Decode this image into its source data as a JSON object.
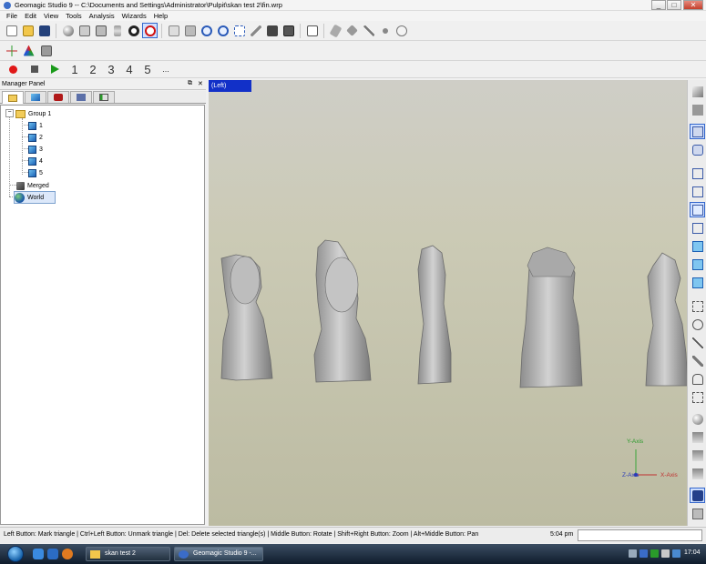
{
  "window": {
    "title": "Geomagic Studio 9 -- C:\\Documents and Settings\\Administrator\\Pulpit\\skan test 2\\fin.wrp",
    "controls": [
      "_",
      "□",
      "✕"
    ]
  },
  "menu": [
    "File",
    "Edit",
    "View",
    "Tools",
    "Analysis",
    "Wizards",
    "Help"
  ],
  "toolbar1": {
    "icons": [
      "new-file-icon",
      "open-folder-icon",
      "save-icon",
      "sphere-icon",
      "cube-view-icon",
      "box-icon",
      "hourglass-icon",
      "rotate-center-icon",
      "target-icon",
      "flat-shade-icon",
      "face-icon",
      "zoom-in-icon",
      "zoom-out-icon",
      "zoom-window-icon",
      "pencil-icon",
      "camera-icon",
      "multi-view-icon",
      "export-icon",
      "eraser-icon",
      "erase-box-icon",
      "pointer-icon",
      "dot-icon",
      "no-entry-icon"
    ]
  },
  "toolbar2": {
    "icons": [
      "axes-icon",
      "color-triangle-icon",
      "transform-icon"
    ]
  },
  "macro_bar": {
    "record_color": "#e01818",
    "stop_color": "#555555",
    "play_color": "#1a9a1a",
    "slots": [
      "1",
      "2",
      "3",
      "4",
      "5",
      "..."
    ]
  },
  "manager_panel": {
    "title": "Manager Panel",
    "pin": "⧉",
    "close": "✕",
    "tabs": [
      "model-manager-tab",
      "layer-tab",
      "display-tab",
      "display-settings-tab",
      "statistics-tab"
    ],
    "tree": {
      "group": "Group 1",
      "expander": "−",
      "children": [
        "1",
        "2",
        "3",
        "4",
        "5"
      ],
      "merged": "Merged",
      "world": "World"
    }
  },
  "viewport": {
    "view_name": "(Left)",
    "background_top": "#cfcec7",
    "background_bottom": "#bcbba2",
    "axes": {
      "y": "Y-Axis",
      "x": "X-Axis",
      "z": "Z-Axis"
    }
  },
  "right_toolbar": {
    "icons": [
      "shade-gradient-icon",
      "shade-flat-icon",
      "plane-icon",
      "cylinder-icon",
      "cube-wire-1-icon",
      "cube-wire-2-icon",
      "cube-wire-3-icon",
      "cube-wire-4-icon",
      "cube-solid-1-icon",
      "cube-solid-2-icon",
      "cube-solid-3-icon",
      "select-rect-icon",
      "select-lasso-icon",
      "select-line-icon",
      "select-paint-icon",
      "select-custom-icon",
      "select-through-icon",
      "sphere-light-icon",
      "stack-1-icon",
      "stack-2-icon",
      "stack-3-icon",
      "camera-view-icon",
      "print-icon"
    ]
  },
  "statusbar": {
    "message": "Left Button: Mark triangle  |  Ctrl+Left Button: Unmark triangle  |  Del: Delete selected triangle(s)  |  Middle Button: Rotate  |  Shift+Right Button: Zoom  |  Alt+Middle Button: Pan",
    "time": "5:04 pm"
  },
  "taskbar": {
    "windows": [
      "skan test 2",
      "Geomagic Studio 9 -..."
    ],
    "clock": "17:04"
  }
}
